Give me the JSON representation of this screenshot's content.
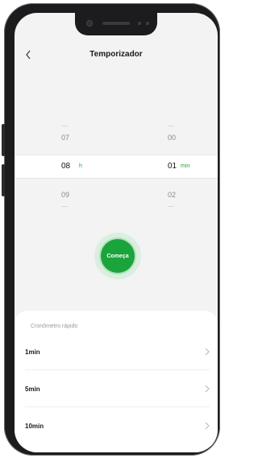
{
  "header": {
    "title": "Temporizador"
  },
  "picker": {
    "hours": {
      "prev": "07",
      "selected": "08",
      "next": "09",
      "unit": "h"
    },
    "minutes": {
      "prev": "00",
      "selected": "01",
      "next": "02",
      "unit": "min"
    }
  },
  "start_button": {
    "label": "Começa"
  },
  "quick_timer": {
    "title": "Cronômetro rápido",
    "items": [
      {
        "label": "1min"
      },
      {
        "label": "5min"
      },
      {
        "label": "10min"
      }
    ]
  },
  "colors": {
    "accent": "#1aa43b",
    "accent_ring": "#d9efdf"
  },
  "icons": {
    "back": "chevron-left-icon",
    "item_arrow": "chevron-right-icon"
  }
}
